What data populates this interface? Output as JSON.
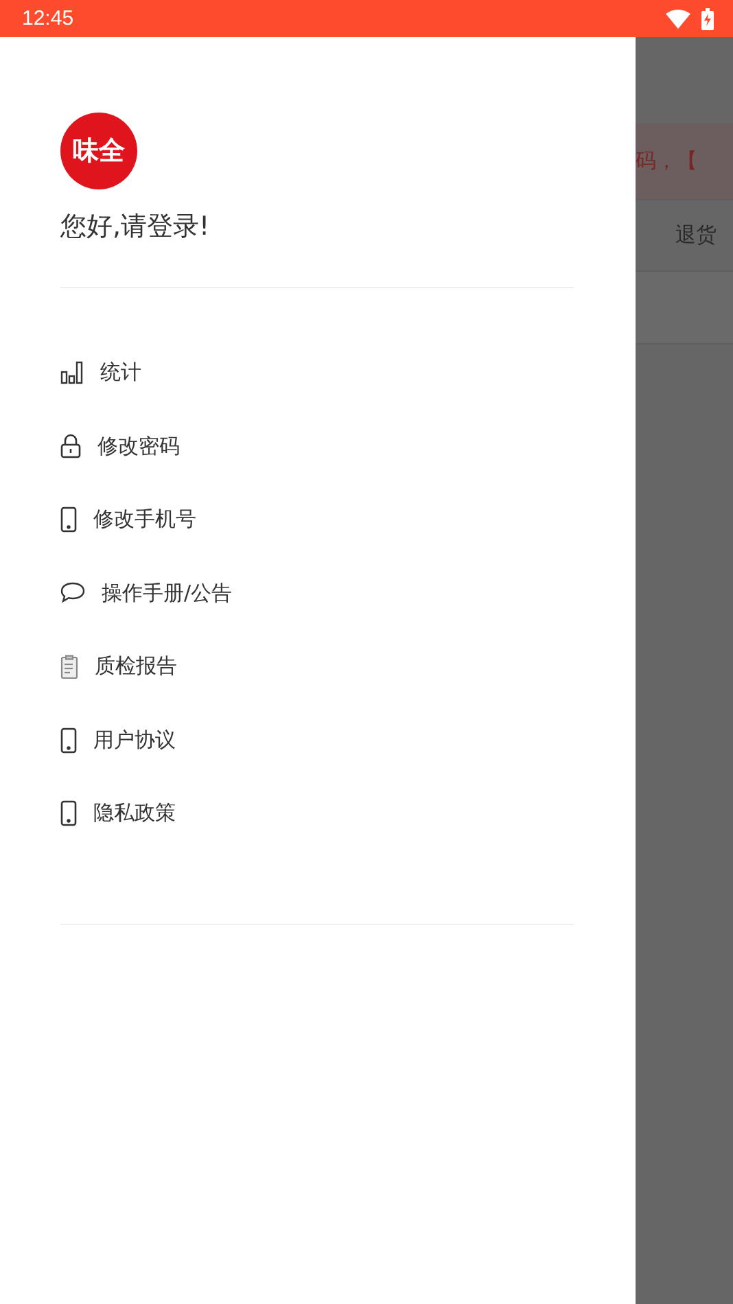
{
  "status_bar": {
    "time": "12:45"
  },
  "drawer": {
    "logo_text": "味全",
    "greeting": "您好,请登录!",
    "items": [
      {
        "label": "统计",
        "kind": "chart"
      },
      {
        "label": "修改密码",
        "kind": "lock"
      },
      {
        "label": "修改手机号",
        "kind": "phone"
      },
      {
        "label": "操作手册/公告",
        "kind": "chat"
      },
      {
        "label": "质检报告",
        "kind": "clipboard"
      },
      {
        "label": "用户协议",
        "kind": "phone"
      },
      {
        "label": "隐私政策",
        "kind": "phone"
      }
    ]
  },
  "background_page": {
    "notice_text": "码，【",
    "row_text": "退货"
  }
}
